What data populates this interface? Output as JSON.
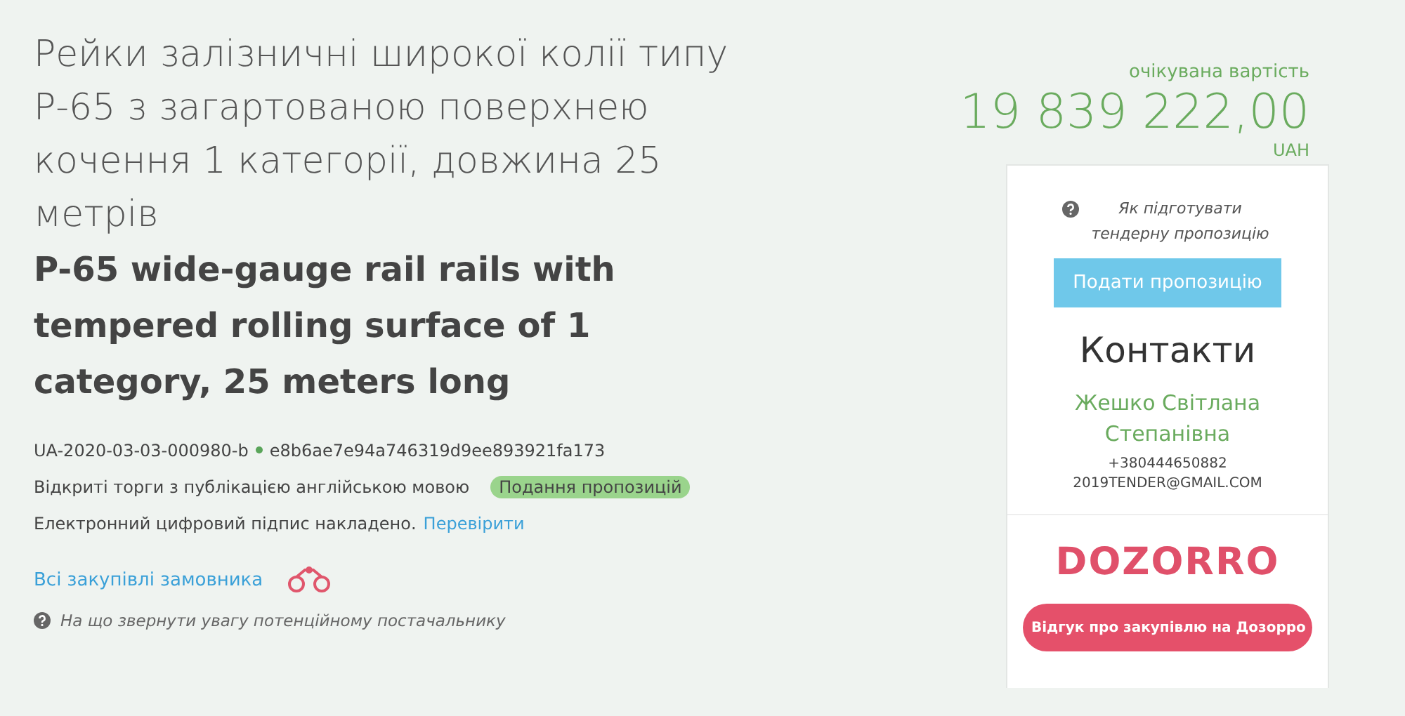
{
  "tender": {
    "title_uk": "Рейки залізничні широкої колії типу Р-65 з загартованою поверхнею кочення 1 категорії, довжина 25 метрів",
    "title_en": "P-65 wide-gauge rail rails with tempered rolling surface of 1 category, 25 meters long",
    "id": "UA-2020-03-03-000980-b",
    "hash": "e8b6ae7e94a746319d9ee893921fa173",
    "procedure": "Відкриті торги з публікацією англійською мовою",
    "status": "Подання пропозицій",
    "signature": "Електронний цифровий підпис накладено.",
    "verify_link": "Перевірити",
    "all_purchases_link": "Всі закупівлі замовника",
    "hint": "На що звернути увагу потенційному постачальнику"
  },
  "budget": {
    "label": "очікувана вартість",
    "amount": "19 839 222,00",
    "currency": "UAH"
  },
  "sidebar": {
    "help_link": "Як підготувати тендерну пропозицію",
    "submit_button": "Подати пропозицію",
    "contacts_title": "Контакти",
    "contact_name": "Жешко Світлана Степанівна",
    "phone": "+380444650882",
    "email": "2019TENDER@GMAIL.COM",
    "logo": "DOZORRO",
    "feedback_button": "Відгук про закупівлю на Дозорро"
  }
}
